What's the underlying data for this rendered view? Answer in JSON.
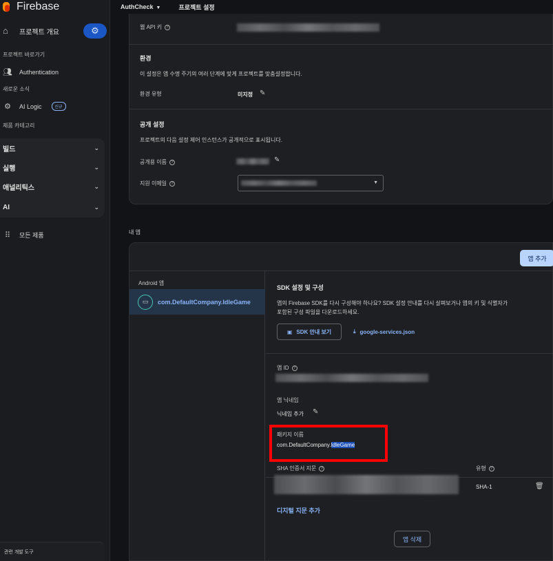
{
  "topbar": {
    "project": "AuthCheck",
    "settings": "프로젝트 설정"
  },
  "sidebar": {
    "brand": "Firebase",
    "overview": "프로젝트 개요",
    "shortcuts_label": "프로젝트 바로가기",
    "authentication": "Authentication",
    "whats_new_label": "새로운 소식",
    "ai_logic": "AI Logic",
    "new_badge": "신규",
    "categories_label": "제품 카테고리",
    "groups": [
      "빌드",
      "실행",
      "애널리틱스",
      "AI"
    ],
    "all_products": "모든 제품",
    "dev_tools": "관련 개발 도구"
  },
  "settings_card": {
    "web_api_key_label": "웹 API 키",
    "env_title": "환경",
    "env_desc": "이 설정은 앱 수명 주기의 여러 단계에 맞게 프로젝트를 맞춤설정합니다.",
    "env_type_label": "환경 유형",
    "env_type_value": "미지정",
    "public_title": "공개 설정",
    "public_desc": "프로젝트의 다음 설정 제어 인스턴스가 공개적으로 표시됩니다.",
    "public_name_label": "공개용 이름",
    "support_email_label": "지원 이메일"
  },
  "my_apps": {
    "title": "내 앱",
    "add_app": "앱 추가",
    "platform": "Android 앱",
    "app_name": "com.DefaultCompany.IdleGame",
    "sdk_title": "SDK 설정 및 구성",
    "sdk_desc_1": "앱의 Firebase SDK를 다시 구성해야 하나요? SDK 설정 안내를 다시 살펴보거나 앱의 키 및 식별자가",
    "sdk_desc_2": "포함된 구성 파일을 다운로드하세요.",
    "sdk_guide_button": "SDK 안내 보기",
    "json_link": "google-services.json",
    "app_id_label": "앱 ID",
    "nickname_label": "앱 닉네임",
    "nickname_add": "닉네임 추가",
    "package_label": "패키지 이름",
    "package_prefix": "com.DefaultCompany.",
    "package_selected": "IdleGame",
    "sha_label": "SHA 인증서 지문",
    "type_label": "유형",
    "sha_type": "SHA-1",
    "add_fingerprint": "디지털 지문 추가",
    "delete_app": "앱 삭제"
  }
}
